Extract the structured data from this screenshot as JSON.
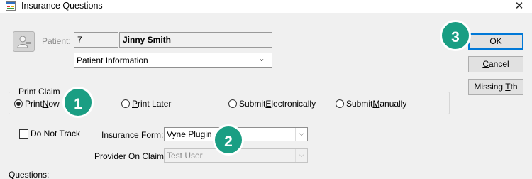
{
  "window": {
    "title": "Insurance Questions",
    "close_glyph": "✕"
  },
  "patient": {
    "label": "Patient:",
    "number": "7",
    "name": "Jinny Smith",
    "info_select": "Patient Information",
    "info_arrow": "⌄"
  },
  "buttons": {
    "ok": {
      "pre": "",
      "key": "O",
      "post": "K"
    },
    "cancel": {
      "pre": "",
      "key": "C",
      "post": "ancel"
    },
    "missing": {
      "pre": "Missing ",
      "key": "T",
      "post": "th"
    }
  },
  "print_claim": {
    "caption": "Print Claim",
    "options": [
      {
        "pre": "Print ",
        "key": "N",
        "post": "ow",
        "selected": true
      },
      {
        "pre": "",
        "key": "P",
        "post": "rint Later",
        "selected": false
      },
      {
        "pre": "Submit ",
        "key": "E",
        "post": "lectronically",
        "selected": false
      },
      {
        "pre": "Submit ",
        "key": "M",
        "post": "anually",
        "selected": false
      }
    ]
  },
  "do_not_track": {
    "label": "Do Not Track",
    "checked": false
  },
  "insurance_form": {
    "label": "Insurance Form:",
    "value": "Vyne Plugin"
  },
  "provider_on_claim": {
    "label": "Provider On Claim:",
    "value": "Test User"
  },
  "questions": {
    "label": "Questions:"
  },
  "callouts": [
    "1",
    "2",
    "3"
  ],
  "colors": {
    "badge": "#1a9e83",
    "default_button_border": "#0078d7"
  },
  "icons": {
    "app": "form-icon",
    "patient": "patient-select-icon",
    "dropdown": "chevron-down-icon"
  }
}
